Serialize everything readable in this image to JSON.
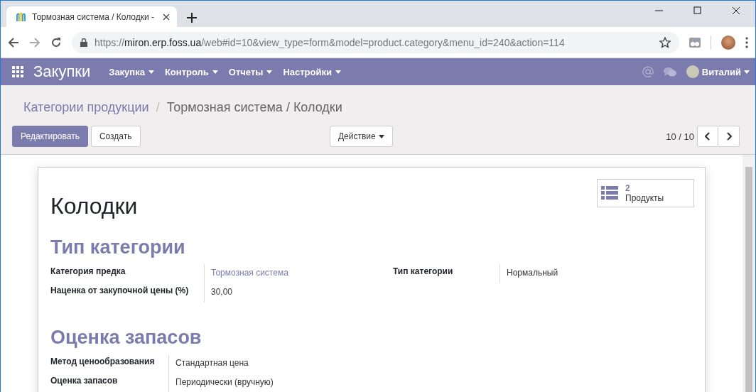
{
  "browser": {
    "tab_title": "Тормозная система / Колодки -",
    "url_scheme": "https://",
    "url_host": "miron.erp.foss.ua",
    "url_path": "/web#id=10&view_type=form&model=product.category&menu_id=240&action=114"
  },
  "navbar": {
    "app_name": "Закупки",
    "menus": [
      "Закупка",
      "Контроль",
      "Отчеты",
      "Настройки"
    ],
    "user": "Виталий"
  },
  "breadcrumb_separator": "/",
  "breadcrumbs": [
    {
      "label": "Категории продукции"
    },
    {
      "label": "Тормозная система / Колодки"
    }
  ],
  "buttons": {
    "edit": "Редактировать",
    "create": "Создать",
    "action": "Действие"
  },
  "pager": "10 / 10",
  "form": {
    "title": "Колодки",
    "smart_button": {
      "count": "2",
      "label": "Продукты"
    },
    "sections": [
      {
        "title": "Тип категории",
        "groups": [
          {
            "fields": [
              {
                "label": "Категория предка",
                "value": "Тормозная система",
                "kind": "link"
              },
              {
                "label": "Наценка от закупочной цены (%)",
                "value": "30,00",
                "kind": "text"
              }
            ]
          },
          {
            "fields": [
              {
                "label": "Тип категории",
                "value": "Нормальный",
                "kind": "text"
              }
            ]
          }
        ]
      },
      {
        "title": "Оценка запасов",
        "groups": [
          {
            "fields": [
              {
                "label": "Метод ценообразования",
                "value": "Стандартная цена",
                "kind": "text"
              },
              {
                "label": "Оценка запасов",
                "value": "Периодически (вручную)",
                "kind": "text"
              }
            ]
          }
        ]
      }
    ]
  }
}
